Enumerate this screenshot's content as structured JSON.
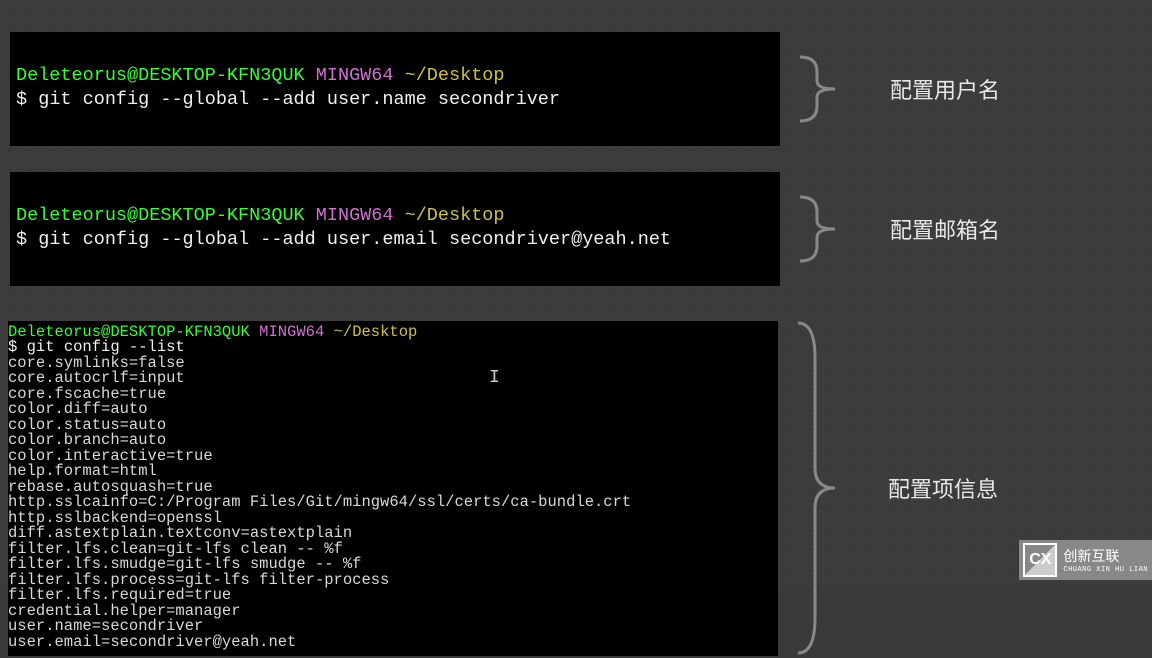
{
  "prompt": {
    "user": "Deleteorus@DESKTOP-KFN3QUK",
    "env": "MINGW64",
    "path": "~/Desktop"
  },
  "terminal1": {
    "command": "git config --global --add user.name secondriver"
  },
  "terminal2": {
    "command": "git config --global --add user.email secondriver@yeah.net"
  },
  "terminal3": {
    "prompt_user_cut": "Deleteorus@DESKTOP-KFN3QUK",
    "command": "git config --list",
    "output_lines": [
      "core.symlinks=false",
      "core.autocrlf=input",
      "core.fscache=true",
      "color.diff=auto",
      "color.status=auto",
      "color.branch=auto",
      "color.interactive=true",
      "help.format=html",
      "rebase.autosquash=true",
      "http.sslcainfo=C:/Program Files/Git/mingw64/ssl/certs/ca-bundle.crt",
      "http.sslbackend=openssl",
      "diff.astextplain.textconv=astextplain",
      "filter.lfs.clean=git-lfs clean -- %f",
      "filter.lfs.smudge=git-lfs smudge -- %f",
      "filter.lfs.process=git-lfs filter-process",
      "filter.lfs.required=true",
      "credential.helper=manager",
      "user.name=secondriver",
      "user.email=secondriver@yeah.net"
    ]
  },
  "labels": {
    "username": "配置用户名",
    "email": "配置邮箱名",
    "info": "配置项信息"
  },
  "watermark": {
    "logo": "CX",
    "cn": "创新互联",
    "py": "CHUANG XIN HU LIAN"
  }
}
